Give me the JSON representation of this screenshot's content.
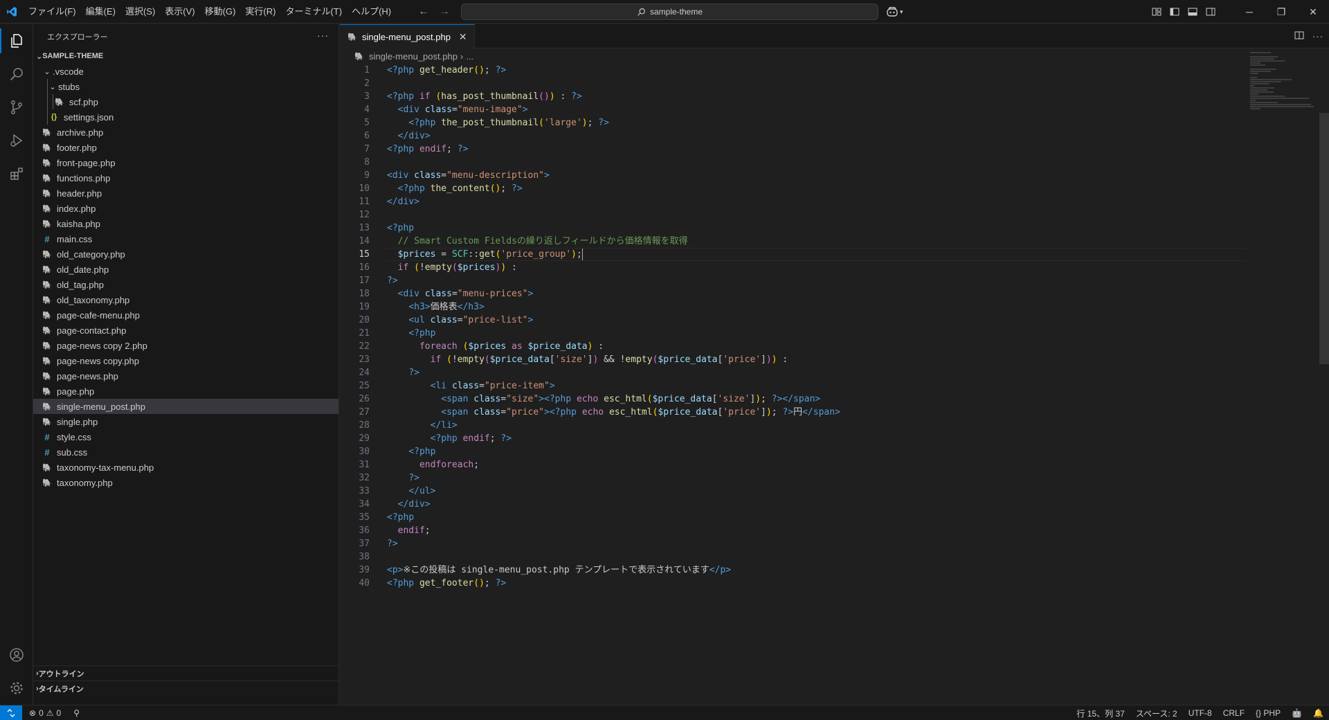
{
  "titlebar": {
    "menus": [
      "ファイル(F)",
      "編集(E)",
      "選択(S)",
      "表示(V)",
      "移動(G)",
      "実行(R)",
      "ターミナル(T)",
      "ヘルプ(H)"
    ],
    "search_text": "sample-theme"
  },
  "sidebar": {
    "title": "エクスプローラー",
    "more": "···",
    "folder": "SAMPLE-THEME",
    "vscode_folder": ".vscode",
    "stubs_folder": "stubs",
    "scf_file": "scf.php",
    "settings_file": "settings.json",
    "files": [
      {
        "name": "archive.php",
        "type": "php"
      },
      {
        "name": "footer.php",
        "type": "php"
      },
      {
        "name": "front-page.php",
        "type": "php"
      },
      {
        "name": "functions.php",
        "type": "php"
      },
      {
        "name": "header.php",
        "type": "php"
      },
      {
        "name": "index.php",
        "type": "php"
      },
      {
        "name": "kaisha.php",
        "type": "php"
      },
      {
        "name": "main.css",
        "type": "css"
      },
      {
        "name": "old_category.php",
        "type": "php"
      },
      {
        "name": "old_date.php",
        "type": "php"
      },
      {
        "name": "old_tag.php",
        "type": "php"
      },
      {
        "name": "old_taxonomy.php",
        "type": "php"
      },
      {
        "name": "page-cafe-menu.php",
        "type": "php"
      },
      {
        "name": "page-contact.php",
        "type": "php"
      },
      {
        "name": "page-news copy 2.php",
        "type": "php"
      },
      {
        "name": "page-news copy.php",
        "type": "php"
      },
      {
        "name": "page-news.php",
        "type": "php"
      },
      {
        "name": "page.php",
        "type": "php"
      },
      {
        "name": "single-menu_post.php",
        "type": "php",
        "selected": true
      },
      {
        "name": "single.php",
        "type": "php"
      },
      {
        "name": "style.css",
        "type": "css"
      },
      {
        "name": "sub.css",
        "type": "css"
      },
      {
        "name": "taxonomy-tax-menu.php",
        "type": "php"
      },
      {
        "name": "taxonomy.php",
        "type": "php"
      }
    ],
    "outline_label": "アウトライン",
    "timeline_label": "タイムライン"
  },
  "editor": {
    "tab_label": "single-menu_post.php",
    "breadcrumb_file": "single-menu_post.php",
    "breadcrumb_more": "...",
    "current_line": 15
  },
  "statusbar": {
    "errors": "0",
    "warnings": "0",
    "position": "行 15、列 37",
    "spaces": "スペース: 2",
    "encoding": "UTF-8",
    "eol": "CRLF",
    "language": "PHP"
  },
  "colors": {
    "accent": "#0078d4",
    "php_icon": "#a074c4",
    "css_icon": "#519aba",
    "json_icon": "#cbcb41"
  }
}
